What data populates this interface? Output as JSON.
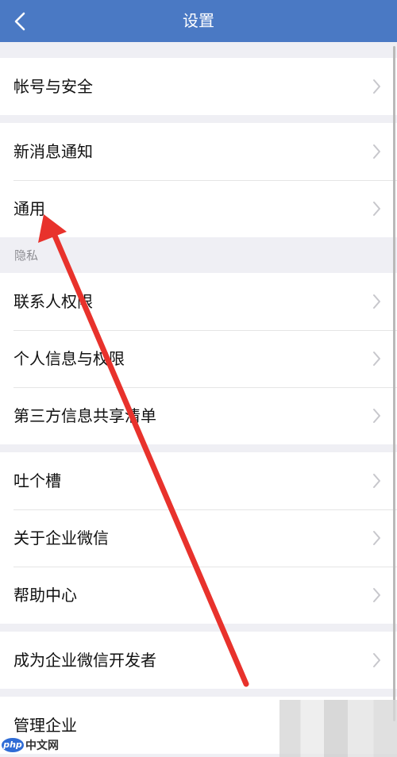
{
  "nav": {
    "title": "设置",
    "back_icon": "chevron-left-icon"
  },
  "groups": [
    {
      "rows": [
        {
          "label": "帐号与安全"
        }
      ]
    },
    {
      "rows": [
        {
          "label": "新消息通知"
        },
        {
          "label": "通用"
        }
      ]
    },
    {
      "header": "隐私",
      "rows": [
        {
          "label": "联系人权限"
        },
        {
          "label": "个人信息与权限"
        },
        {
          "label": "第三方信息共享清单"
        }
      ]
    },
    {
      "rows": [
        {
          "label": "吐个槽"
        },
        {
          "label": "关于企业微信"
        },
        {
          "label": "帮助中心"
        }
      ]
    },
    {
      "rows": [
        {
          "label": "成为企业微信开发者"
        }
      ]
    },
    {
      "rows": [
        {
          "label": "管理企业"
        }
      ]
    }
  ],
  "watermark": {
    "logo": "php",
    "text": "中文网"
  },
  "colors": {
    "nav_background": "#4a79c4",
    "page_background": "#efeff4",
    "annotation_arrow": "#e8322c"
  }
}
